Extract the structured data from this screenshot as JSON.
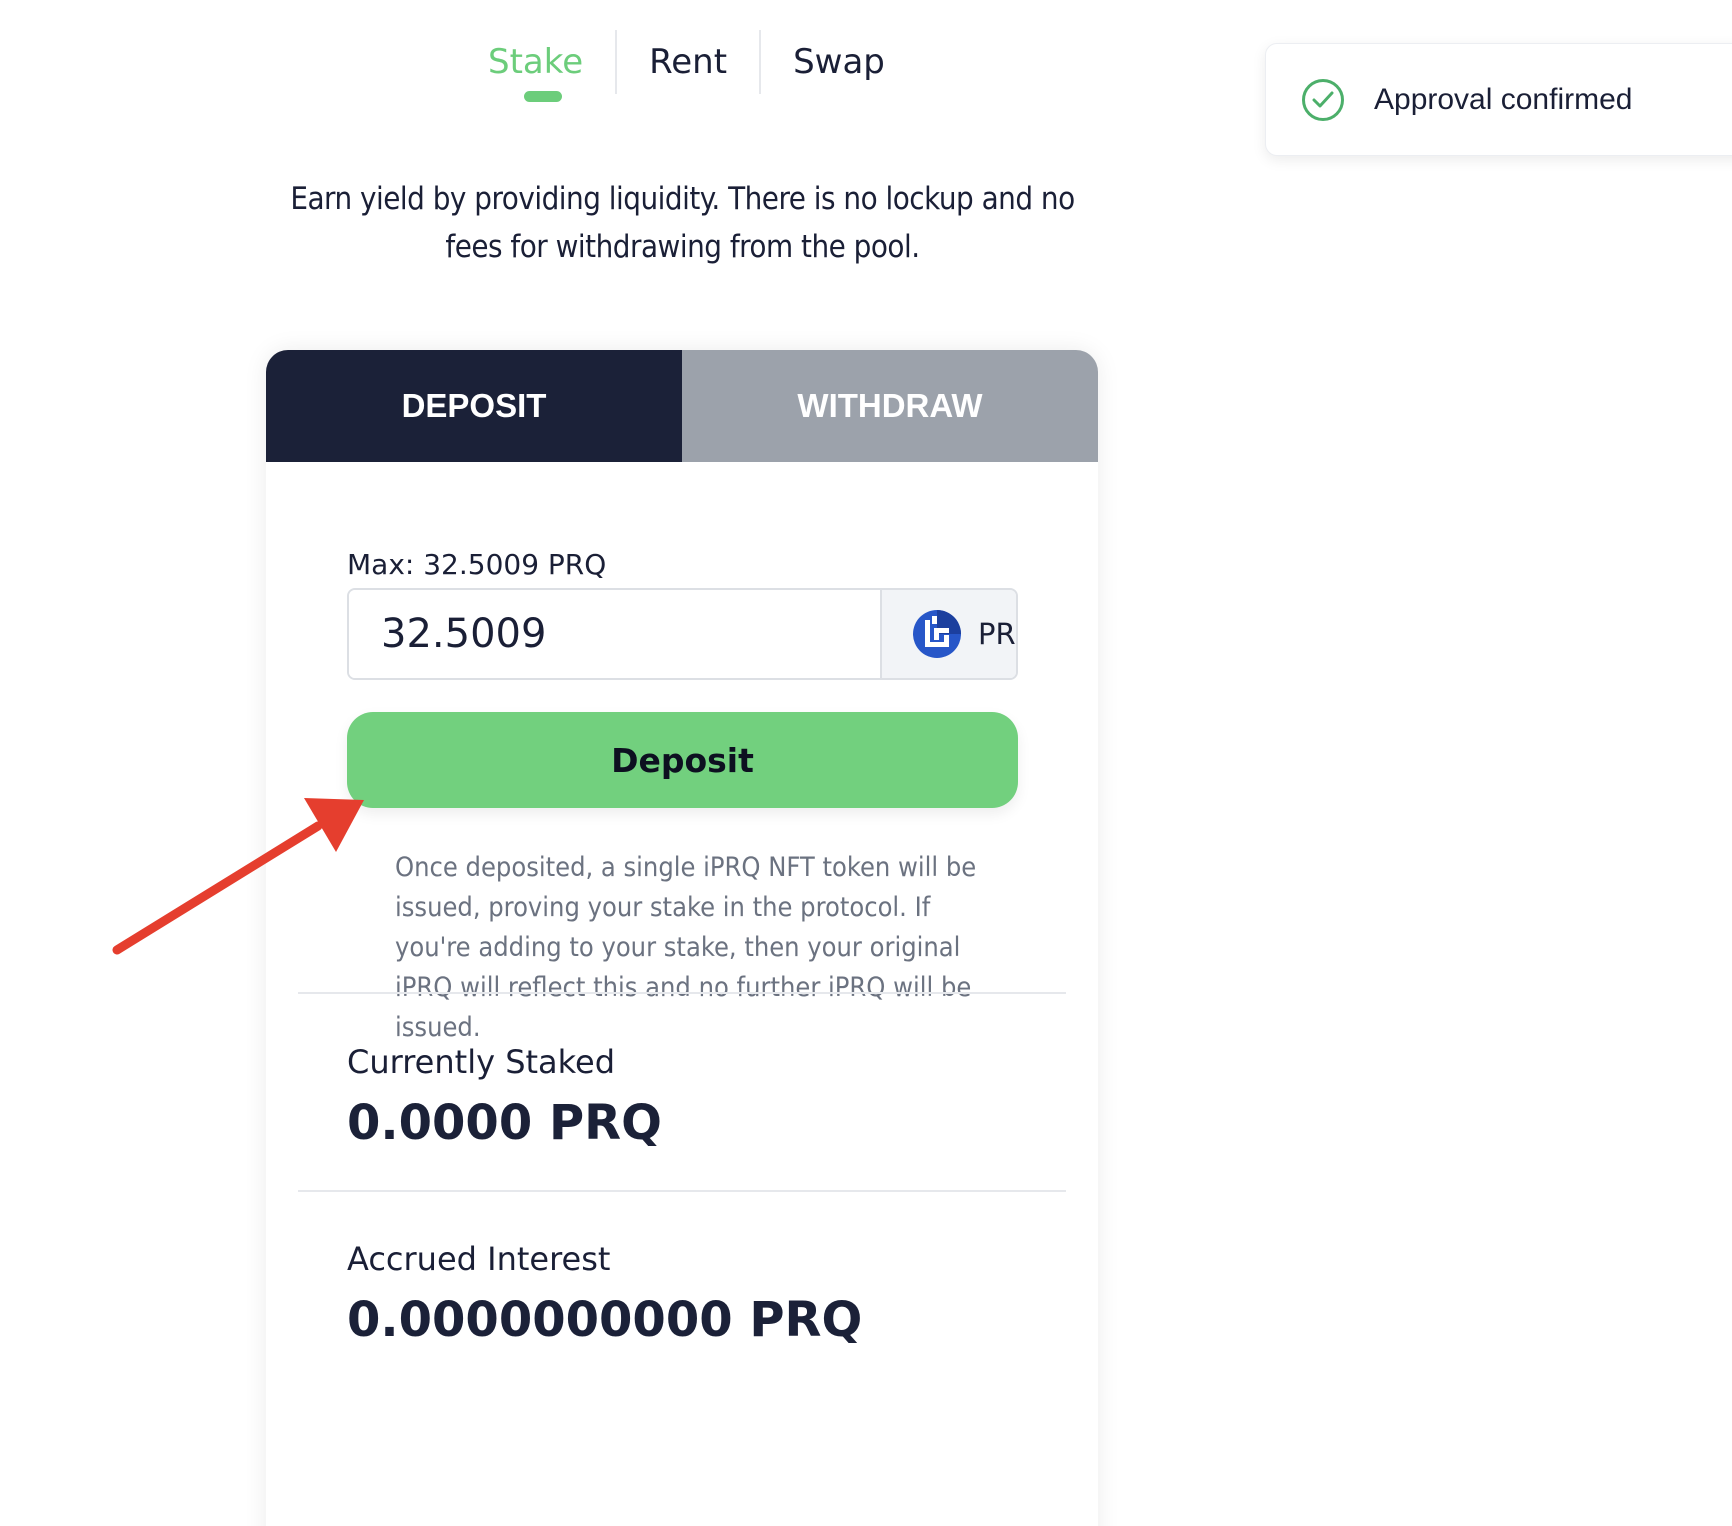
{
  "nav": {
    "items": [
      {
        "label": "Stake",
        "active": true
      },
      {
        "label": "Rent",
        "active": false
      },
      {
        "label": "Swap",
        "active": false
      }
    ]
  },
  "toast": {
    "icon": "check-circle-icon",
    "message": "Approval confirmed"
  },
  "description": "Earn yield by providing liquidity. There is no lockup and no fees for withdrawing from the pool.",
  "card": {
    "tabs": {
      "deposit": "DEPOSIT",
      "withdraw": "WITHDRAW"
    },
    "max_label": "Max: 32.5009 PRQ",
    "amount_value": "32.5009",
    "token": {
      "icon": "prq-coin-icon",
      "symbol": "PRQ"
    },
    "deposit_button": "Deposit",
    "note": "Once deposited, a single iPRQ NFT token will be issued, proving your stake in the protocol. If you're adding to your stake, then your original iPRQ will reflect this and no further iPRQ will be issued.",
    "currently_staked": {
      "label": "Currently Staked",
      "value": "0.0000 PRQ"
    },
    "accrued_interest": {
      "label": "Accrued Interest",
      "value": "0.0000000000 PRQ"
    }
  },
  "colors": {
    "accent": "#6ccd7b",
    "deposit_button": "#72d07e",
    "active_tab": "#1b2138",
    "inactive_tab": "#9ca2ab",
    "annotation_arrow": "#e53e2e"
  }
}
